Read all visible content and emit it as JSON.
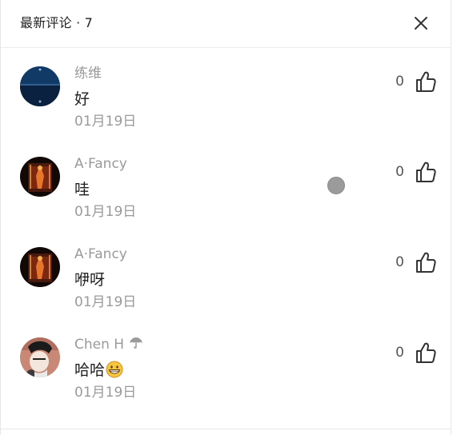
{
  "header": {
    "title": "最新评论 · 7"
  },
  "comments": [
    {
      "author": "练维",
      "content": "好",
      "date": "01月19日",
      "likes": "0",
      "avatar_icon": "dark-blue-landscape-avatar"
    },
    {
      "author": "A·Fancy",
      "content": "哇",
      "date": "01月19日",
      "likes": "0",
      "avatar_icon": "glowing-figure-avatar"
    },
    {
      "author": "A·Fancy",
      "content": "咿呀",
      "date": "01月19日",
      "likes": "0",
      "avatar_icon": "glowing-figure-avatar"
    },
    {
      "author": "Chen H",
      "content": "哈哈",
      "date": "01月19日",
      "likes": "0",
      "avatar_icon": "person-portrait-avatar",
      "author_badge_icon": "umbrella-icon",
      "content_emoji": "grinning-face-emoji"
    }
  ],
  "colors": {
    "muted_text": "#9a9a9a",
    "body_text": "#1f1f1f",
    "icon": "#333333"
  }
}
